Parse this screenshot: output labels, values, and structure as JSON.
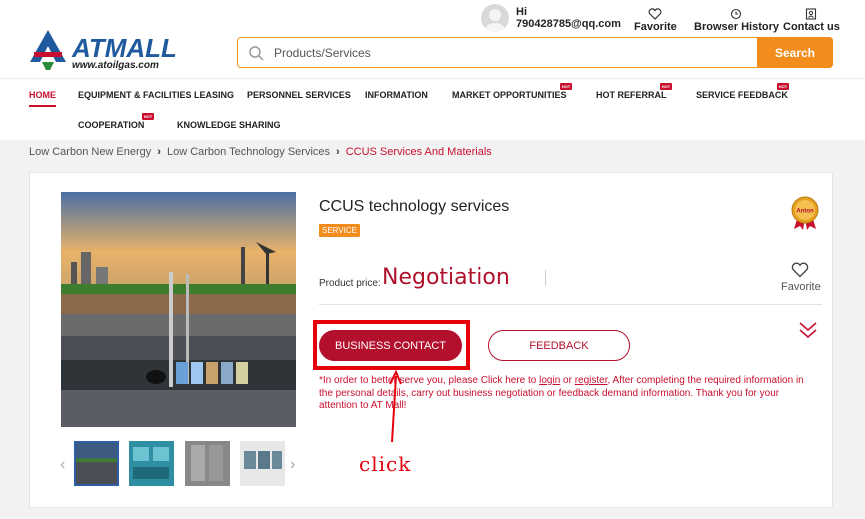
{
  "header": {
    "logo_text": "ATMALL",
    "logo_url_text": "www.atoilgas.com",
    "search_placeholder": "Products/Services",
    "search_button": "Search",
    "user_greeting": "Hi",
    "user_email": "790428785@qq.com",
    "favorite_label": "Favorite",
    "history_label": "Browser History",
    "contact_label": "Contact us"
  },
  "nav": {
    "items": [
      {
        "label": "HOME",
        "active": true,
        "hot": false
      },
      {
        "label": "EQUIPMENT & FACILITIES LEASING",
        "hot": false
      },
      {
        "label": "PERSONNEL SERVICES",
        "hot": false
      },
      {
        "label": "INFORMATION",
        "hot": false
      },
      {
        "label": "MARKET OPPORTUNITIES",
        "hot": true
      },
      {
        "label": "HOT REFERRAL",
        "hot": true
      },
      {
        "label": "SERVICE FEEDBACK",
        "hot": true
      },
      {
        "label": "COOPERATION",
        "hot": true
      },
      {
        "label": "KNOWLEDGE SHARING",
        "hot": false
      }
    ],
    "hot_label": "HOT"
  },
  "breadcrumb": [
    "Low Carbon New Energy",
    "Low Carbon Technology Services",
    "CCUS Services And Materials"
  ],
  "product": {
    "title": "CCUS technology services",
    "tag": "SERVICE",
    "price_label": "Product price:",
    "price_value": "Negotiation",
    "favorite_label": "Favorite",
    "badge_text": "Anton",
    "contact_button": "BUSINESS CONTACT",
    "feedback_button": "FEEDBACK",
    "notice_pre": "*In order to better serve you, please Click here to ",
    "notice_login": "login",
    "notice_or": " or ",
    "notice_register": "register",
    "notice_post": ", After completing the required information in the personal details, carry out business negotiation or feedback demand information. Thank you for your attention to AT Mall!"
  },
  "annotation": {
    "click_text": "click",
    "color": "#e5000b"
  },
  "colors": {
    "brand_red": "#b2102c",
    "accent_orange": "#f28c1c",
    "logo_blue": "#1f5a9e"
  }
}
